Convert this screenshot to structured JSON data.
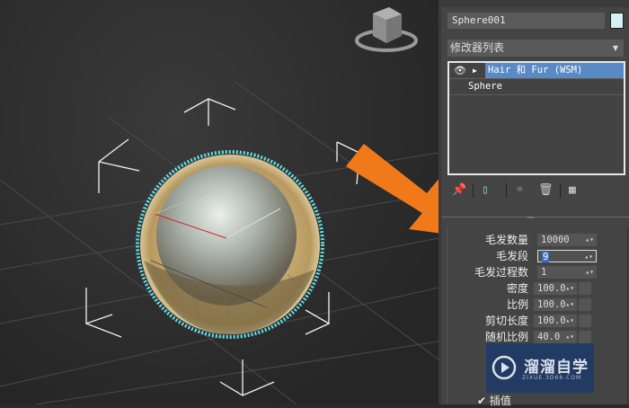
{
  "viewport": {
    "view_cube": "viewcube-icon"
  },
  "panel": {
    "object_name": "Sphere001",
    "object_color": "#d4f2f4",
    "modifier_list_label": "修改器列表",
    "stack": [
      {
        "label": "Hair 和 Fur (WSM)",
        "selected": true
      },
      {
        "label": "Sphere",
        "selected": false
      }
    ],
    "tools": [
      "pin-stack-icon",
      "show-end-result-icon",
      "make-unique-icon",
      "remove-modifier-icon",
      "configure-sets-icon"
    ],
    "params": [
      {
        "label": "毛发数量",
        "value": "10000"
      },
      {
        "label": "毛发段",
        "value": "9",
        "active": true
      },
      {
        "label": "毛发过程数",
        "value": "1"
      },
      {
        "label": "密度",
        "value": "100.0"
      },
      {
        "label": "比例",
        "value": "100.0"
      },
      {
        "label": "剪切长度",
        "value": "100.0"
      },
      {
        "label": "随机比例",
        "value": "40.0"
      }
    ],
    "interpolate_label": "插值",
    "interpolate_checked": true
  },
  "watermark": {
    "title": "溜溜自学",
    "url": "ZIXUE.3D66.COM"
  },
  "colors": {
    "selection": "#5a8ac6",
    "arrow": "#f07a1a",
    "fur_outline": "#5fe0e8"
  }
}
